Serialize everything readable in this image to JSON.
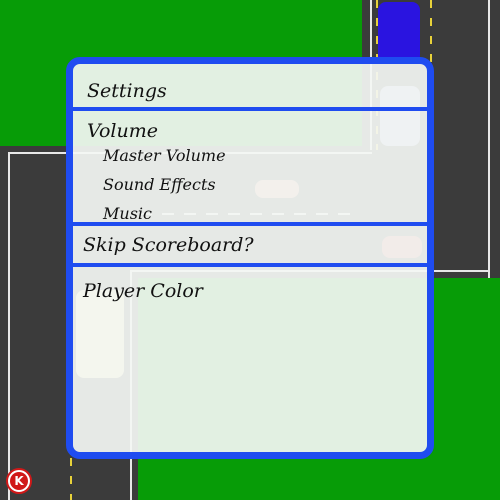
{
  "settings": {
    "title": "Settings",
    "volume": {
      "heading": "Volume",
      "items": [
        "Master Volume",
        "Sound Effects",
        "Music"
      ]
    },
    "skip_scoreboard": "Skip Scoreboard?",
    "player_color": "Player Color"
  },
  "game": {
    "logo_letter": "K",
    "colors": {
      "grass": "#079c07",
      "road": "#3b3b3b",
      "panel_border": "#1f4cf0",
      "player_car": "#2a14e0"
    }
  }
}
